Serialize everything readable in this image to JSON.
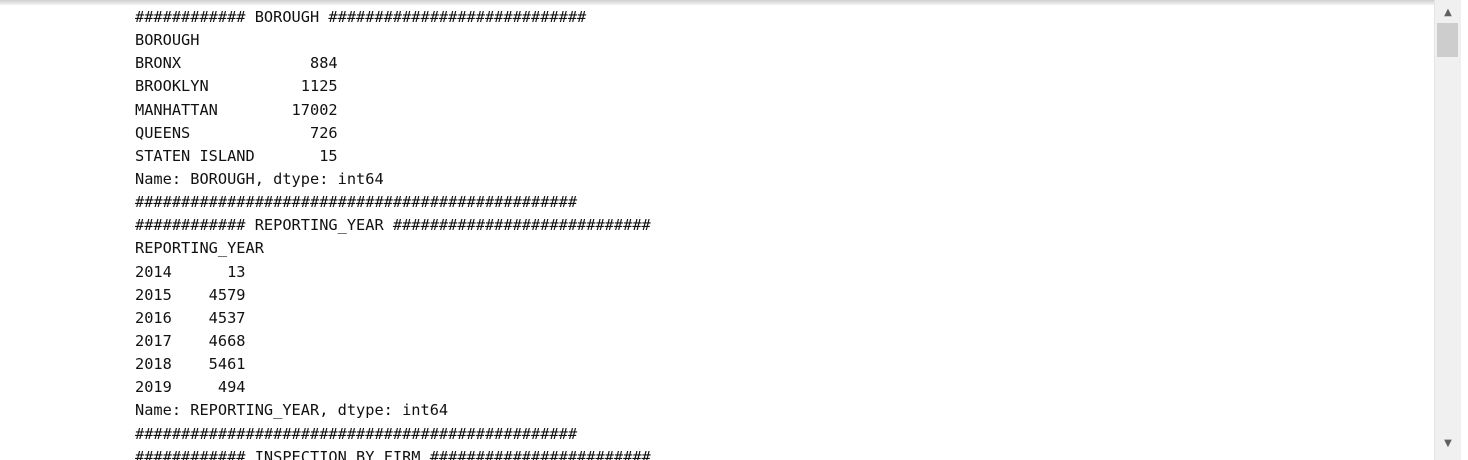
{
  "output": {
    "lines": [
      "############ BOROUGH ############################",
      "BOROUGH",
      "BRONX              884",
      "BROOKLYN          1125",
      "MANHATTAN        17002",
      "QUEENS             726",
      "STATEN ISLAND       15",
      "Name: BOROUGH, dtype: int64",
      "################################################",
      "############ REPORTING_YEAR ############################",
      "REPORTING_YEAR",
      "2014      13",
      "2015    4579",
      "2016    4537",
      "2017    4668",
      "2018    5461",
      "2019     494",
      "Name: REPORTING_YEAR, dtype: int64",
      "################################################",
      "############ INSPECTION_BY_FIRM ########################"
    ]
  },
  "scrollbar": {
    "up_icon": "▲",
    "down_icon": "▼"
  }
}
